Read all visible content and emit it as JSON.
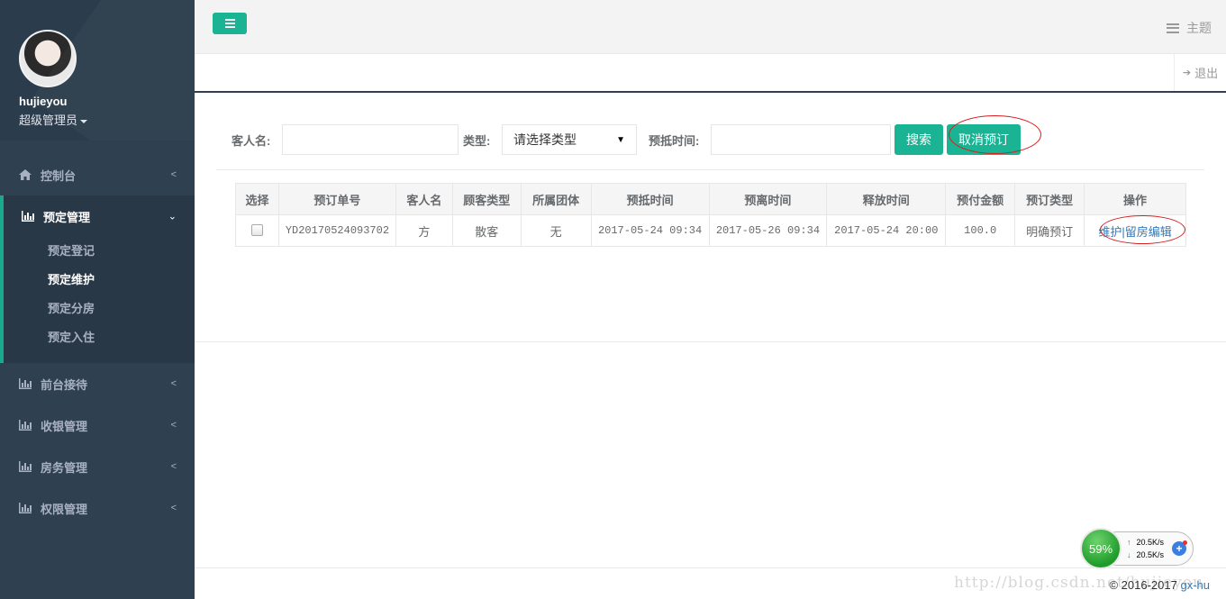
{
  "sidebar": {
    "profile": {
      "username": "hujieyou",
      "role": "超级管理员"
    },
    "items": [
      {
        "label": "控制台",
        "icon": "home-icon"
      },
      {
        "label": "预定管理",
        "icon": "bar-chart-icon",
        "expanded": true,
        "children": [
          "预定登记",
          "预定维护",
          "预定分房",
          "预定入住"
        ],
        "current": "预定维护"
      },
      {
        "label": "前台接待",
        "icon": "bar-chart-icon"
      },
      {
        "label": "收银管理",
        "icon": "bar-chart-icon"
      },
      {
        "label": "房务管理",
        "icon": "bar-chart-icon"
      },
      {
        "label": "权限管理",
        "icon": "bar-chart-icon"
      }
    ]
  },
  "topbar": {
    "theme_label": "主题",
    "logout_label": "退出"
  },
  "search": {
    "guest_label": "客人名:",
    "guest_value": "",
    "type_label": "类型:",
    "type_selected": "请选择类型",
    "arrive_label": "预抵时间:",
    "arrive_value": "",
    "search_button": "搜索",
    "cancel_button": "取消预订"
  },
  "table": {
    "columns": [
      "选择",
      "预订单号",
      "客人名",
      "顾客类型",
      "所属团体",
      "预抵时间",
      "预离时间",
      "释放时间",
      "预付金额",
      "预订类型",
      "操作"
    ],
    "rows": [
      {
        "order_no": "YD20170524093702",
        "guest": "方",
        "customer_type": "散客",
        "group": "无",
        "arrive_time": "2017-05-24 09:34",
        "leave_time": "2017-05-26 09:34",
        "release_time": "2017-05-24 20:00",
        "prepay": "100.0",
        "booking_type": "明确预订",
        "action_maintain": "维护",
        "action_sep": "|",
        "action_edit": "留房编辑"
      }
    ]
  },
  "footer": {
    "copyright": "© 2016-2017 ",
    "author": "gx-hu",
    "watermark": "http://blog.csdn.net/hujieyou"
  },
  "net_widget": {
    "percent": "59%",
    "up_speed": "20.5K/s",
    "down_speed": "20.5K/s"
  },
  "colors": {
    "sidebar": "#2f4050",
    "accent": "#1ab394",
    "annotation": "#d81e1e",
    "link": "#337ab7"
  }
}
